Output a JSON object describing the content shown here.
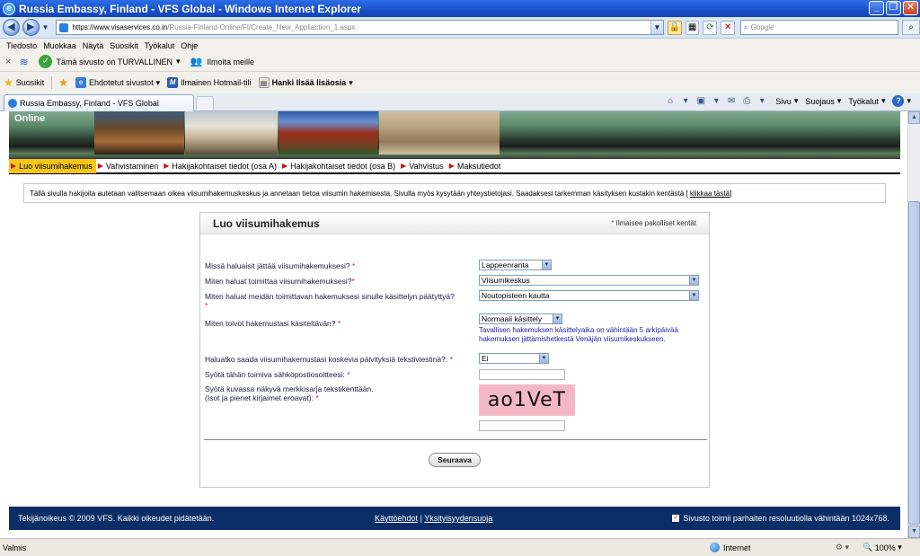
{
  "window": {
    "title": "Russia Embassy, Finland - VFS Global - Windows Internet Explorer",
    "logo_letter": "e",
    "controls": [
      "_",
      "❐",
      "✕"
    ]
  },
  "address": {
    "url_prefix": "https://www.",
    "url_host": "visaservices.co.in",
    "url_path": "/Russia-Finland-Online/FI/Create_New_Appliaction_1.aspx",
    "search_placeholder": "Google"
  },
  "menu": [
    "Tiedosto",
    "Muokkaa",
    "Näytä",
    "Suosikit",
    "Työkalut",
    "Ohje"
  ],
  "linksbar": {
    "safe_label": "Tämä sivusto on TURVALLINEN",
    "report_label": "Ilmoita meille"
  },
  "favbar": {
    "favorites_label": "Suosikit",
    "suggested_label": "Ehdotetut sivustot",
    "hotmail_label": "Ilmainen Hotmail-tili",
    "addons_label": "Hanki lisää lisäosia"
  },
  "tab": {
    "label": "Russia Embassy, Finland - VFS Global"
  },
  "cmdbar": {
    "page_label": "Sivu",
    "safety_label": "Suojaus",
    "tools_label": "Työkalut"
  },
  "banner": {
    "online_label": "Online"
  },
  "steps": [
    "Luo viisumihakemus",
    "Vahvistaminen",
    "Hakijakohtaiset tiedot (osa A)",
    "Hakijakohtaiset tiedot (osa B)",
    "Vahvistus",
    "Maksutiedot"
  ],
  "info": {
    "text": "Tällä sivulla hakijoita autetaan valitsemaan oikea viisumihakemuskeskus ja annetaan tietoa viisumin hakemisesta. Sivulla myös kysytään yhteystietojasi. Saadaksesi tarkemman käsityksen kustakin kentästä [",
    "link": "klikkaa tästä",
    "close": " ]"
  },
  "form": {
    "title": "Luo viisumihakemus",
    "required_note": "Ilmaisee pakolliset kentät",
    "required_mark": "*",
    "fields": {
      "center_label": "Missä haluaisit jättää viisumihakemuksesi?",
      "center_value": "Lappeenranta",
      "submit_label": "Miten haluat toimittaa viisumihakemuksesi?",
      "submit_value": "Viisumikeskus",
      "return_label": "Miten haluat meidän toimittavan hakemuksesi sinulle käsittelyn päätyttyä?",
      "return_value": "Noutopisteen kautta",
      "processing_label": "Miten toivot hakemustasi käsiteltävän?",
      "processing_value": "Normaali käsittely",
      "processing_help": "Tavallisen hakemuksen käsittelyaika on vähintään 5 arkipäivää hakemuksen jättämishetkestä Venäjän viisumikeskukseen.",
      "sms_label": "Haluatko saada viisumihakemustasi koskevia päivityksiä tekstiviestinä?:",
      "sms_value": "Ei",
      "email_label": "Syötä tähän toimiva sähköpostiosoitteesi:",
      "captcha_label": "Syötä kuvassa näkyvä merkkisarja tekstikenttään.",
      "captcha_note": "(Isot ja pienet kirjaimet eroavat):",
      "captcha_text": "ao1VeT"
    },
    "next_button": "Seuraava"
  },
  "footer": {
    "copyright": "Tekijänoikeus © 2009 VFS. Kaikki oikeudet pidätetään.",
    "terms": "Käyttöehdot",
    "separator": "|",
    "privacy": "Yksityisyydensuoja",
    "resolution": "Sivusto toimii parhaiten resoluutiolla vähintään 1024x768."
  },
  "status": {
    "text": "Valmis",
    "zone": "Internet",
    "zoom": "100%"
  }
}
